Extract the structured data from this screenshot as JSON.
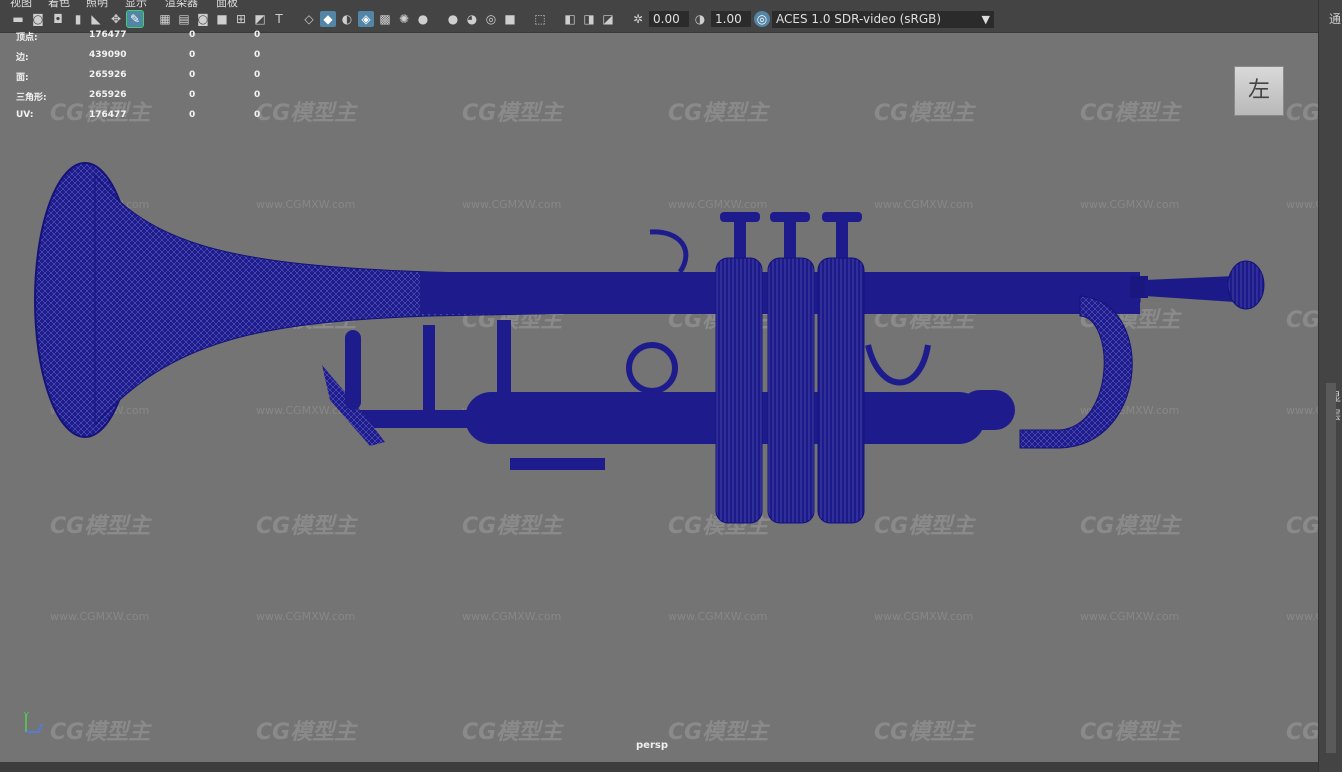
{
  "menu": [
    "视图",
    "着色",
    "照明",
    "显示",
    "渲染器",
    "面板"
  ],
  "toolbar": {
    "exposure_value": "0.00",
    "gamma_value": "1.00",
    "color_space": "ACES 1.0 SDR-video (sRGB)"
  },
  "stats": [
    {
      "label": "顶点:",
      "value": "176477",
      "sel": "0",
      "extra": "0"
    },
    {
      "label": "边:",
      "value": "439090",
      "sel": "0",
      "extra": "0"
    },
    {
      "label": "面:",
      "value": "265926",
      "sel": "0",
      "extra": "0"
    },
    {
      "label": "三角形:",
      "value": "265926",
      "sel": "0",
      "extra": "0"
    },
    {
      "label": "UV:",
      "value": "176477",
      "sel": "0",
      "extra": "0"
    }
  ],
  "view_cube_label": "左",
  "camera_label": "persp",
  "axis": {
    "y": "Y",
    "z": "Z"
  },
  "right_panel_chars": [
    "通",
    "显",
    "层"
  ],
  "watermark": {
    "logo": "CG模型主",
    "url": "www.CGMXW.com"
  },
  "colors": {
    "viewport_bg": "#747474",
    "wireframe": "#1c1a8a",
    "toolbar_active": "#5285a6",
    "tool_highlight": "#3fd16b"
  },
  "icons": [
    "camera-select-icon",
    "camera-lock-icon",
    "camera-attr-icon",
    "bookmark-icon",
    "image-plane-icon",
    "2d-pan-icon",
    "grease-pencil-icon",
    "grid-icon",
    "film-gate-icon",
    "resolution-gate-icon",
    "gate-mask-icon",
    "field-chart-icon",
    "safe-action-icon",
    "safe-title-icon",
    "wireframe-icon",
    "smooth-shade-icon",
    "default-material-icon",
    "wireframe-on-shaded-icon",
    "textured-icon",
    "lights-icon",
    "shadows-icon",
    "ambient-occlusion-icon",
    "motion-blur-icon",
    "anti-aliasing-icon",
    "depth-of-field-icon",
    "isolate-select-icon",
    "xray-icon",
    "xray-active-icon",
    "xray-joints-icon",
    "backface-culling-icon",
    "exposure-icon",
    "gamma-icon",
    "color-management-icon"
  ]
}
